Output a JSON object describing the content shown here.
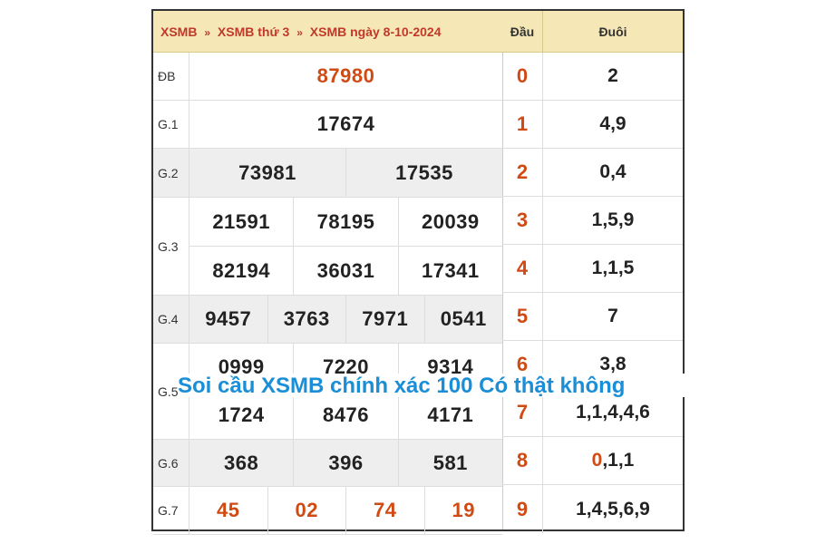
{
  "breadcrumb": [
    "XSMB",
    "XSMB thứ 3",
    "XSMB ngày 8-10-2024"
  ],
  "breadcrumb_sep": "»",
  "prizes": [
    {
      "label": "ĐB",
      "lines": [
        [
          "87980"
        ]
      ],
      "red": true
    },
    {
      "label": "G.1",
      "lines": [
        [
          "17674"
        ]
      ]
    },
    {
      "label": "G.2",
      "lines": [
        [
          "73981",
          "17535"
        ]
      ]
    },
    {
      "label": "G.3",
      "lines": [
        [
          "21591",
          "78195",
          "20039"
        ],
        [
          "82194",
          "36031",
          "17341"
        ]
      ]
    },
    {
      "label": "G.4",
      "lines": [
        [
          "9457",
          "3763",
          "7971",
          "0541"
        ]
      ]
    },
    {
      "label": "G.5",
      "lines": [
        [
          "0999",
          "7220",
          "9314"
        ],
        [
          "1724",
          "8476",
          "4171"
        ]
      ]
    },
    {
      "label": "G.6",
      "lines": [
        [
          "368",
          "396",
          "581"
        ]
      ]
    },
    {
      "label": "G.7",
      "lines": [
        [
          "45",
          "02",
          "74",
          "19"
        ]
      ],
      "red": true
    }
  ],
  "loto": {
    "head_label": "Đầu",
    "tail_label": "Đuôi",
    "rows": [
      {
        "dau": "0",
        "duoi": "2"
      },
      {
        "dau": "1",
        "duoi": "4,9"
      },
      {
        "dau": "2",
        "duoi": "0,4"
      },
      {
        "dau": "3",
        "duoi": "1,5,9"
      },
      {
        "dau": "4",
        "duoi": "1,1,5"
      },
      {
        "dau": "5",
        "duoi": "7"
      },
      {
        "dau": "6",
        "duoi": "3,8"
      },
      {
        "dau": "7",
        "duoi": "1,1,4,4,6"
      },
      {
        "dau": "8",
        "duoi_red": "0",
        "duoi": ",1,1"
      },
      {
        "dau": "9",
        "duoi": "1,4,5,6,9"
      }
    ]
  },
  "overlay_text": "Soi cầu XSMB chính xác 100 Có thật không",
  "colors": {
    "accent_red": "#d04a14",
    "header_bg": "#f6e8b6",
    "overlay_blue": "#1a8ed6"
  }
}
